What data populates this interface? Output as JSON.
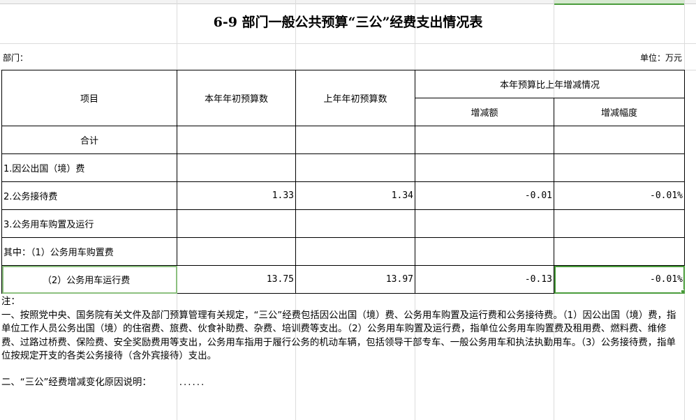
{
  "title": "6-9  部门一般公共预算“三公”经费支出情况表",
  "dept_label": "部门：",
  "unit_label": "单位：万元",
  "headers": {
    "item": "项目",
    "current": "本年年初预算数",
    "previous": "上年年初预算数",
    "change_group": "本年预算比上年增减情况",
    "change_amount": "增减额",
    "change_rate": "增减幅度"
  },
  "rows": [
    {
      "label": "合计",
      "current": "",
      "previous": "",
      "amount": "",
      "rate": ""
    },
    {
      "label": "1.因公出国（境）费",
      "current": "",
      "previous": "",
      "amount": "",
      "rate": ""
    },
    {
      "label": "2.公务接待费",
      "current": "1.33",
      "previous": "1.34",
      "amount": "-0.01",
      "rate": "-0.01%"
    },
    {
      "label": "3.公务用车购置及运行",
      "current": "",
      "previous": "",
      "amount": "",
      "rate": ""
    },
    {
      "label": "其中：（1）公务用车购置费",
      "current": "",
      "previous": "",
      "amount": "",
      "rate": ""
    },
    {
      "label": "（2）公务用车运行费",
      "current": "13.75",
      "previous": "13.97",
      "amount": "-0.13",
      "rate": "-0.01%"
    }
  ],
  "notes": {
    "heading": "注：",
    "para1": "一、按照党中央、国务院有关文件及部门预算管理有关规定，“三公”经费包括因公出国（境）费、公务用车购置及运行费和公务接待费。（1）因公出国（境）费，指单位工作人员公务出国（境）的住宿费、旅费、伙食补助费、杂费、培训费等支出。（2）公务用车购置及运行费，指单位公务用车购置费及租用费、燃料费、维修费、过路过桥费、保险费、安全奖励费用等支出，公务用车指用于履行公务的机动车辆，包括领导干部专车、一般公务用车和执法执勤用车。（3）公务接待费，指单位按规定开支的各类公务接待（含外宾接待）支出。",
    "reason_label": "二、“三公”经费增减变化原因说明：",
    "reason_value": "......"
  }
}
